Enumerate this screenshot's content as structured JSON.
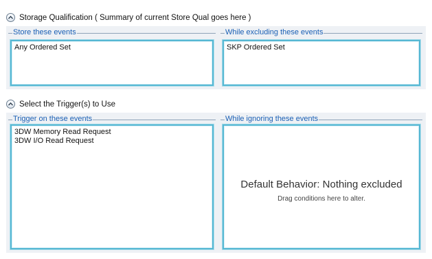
{
  "storage": {
    "header": "Storage Qualification ( Summary of current Store Qual goes here )",
    "store_group": {
      "title": "Store these events",
      "items": [
        "Any Ordered Set"
      ]
    },
    "exclude_group": {
      "title": "While excluding these events",
      "items": [
        "SKP Ordered Set"
      ]
    }
  },
  "trigger": {
    "header": "Select the Trigger(s) to Use",
    "trigger_group": {
      "title": "Trigger on these events",
      "items": [
        "3DW Memory Read Request",
        "3DW I/O Read Request"
      ]
    },
    "ignore_group": {
      "title": "While ignoring these events",
      "placeholder_main": "Default Behavior: Nothing excluded",
      "placeholder_sub": "Drag conditions here to alter."
    }
  },
  "icons": {
    "collapse": "chevron-up-icon"
  },
  "colors": {
    "group_title": "#1a5fb4",
    "drop_border": "#56b8d3",
    "panel_background": "#eef1f5"
  }
}
